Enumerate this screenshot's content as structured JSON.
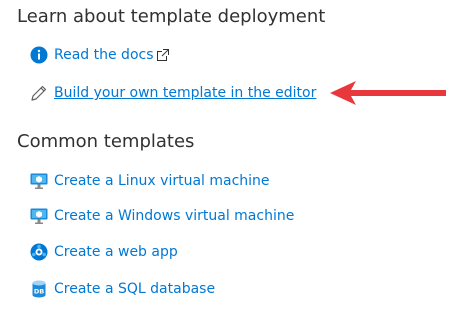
{
  "learn": {
    "heading": "Learn about template deployment",
    "links": {
      "docs": "Read the docs",
      "editor": "Build your own template in the editor"
    }
  },
  "common": {
    "heading": "Common templates",
    "links": {
      "linux": "Create a Linux virtual machine",
      "windows": "Create a Windows virtual machine",
      "webapp": "Create a web app",
      "sql": "Create a SQL database"
    },
    "sql_icon_text": "DB"
  },
  "colors": {
    "link": "#0078d4",
    "heading": "#323130",
    "annotation_arrow": "#e8383d"
  },
  "icons": {
    "docs": "info-icon",
    "external": "external-link-icon",
    "editor": "pencil-icon",
    "linux": "virtual-machine-icon",
    "windows": "virtual-machine-icon",
    "webapp": "web-app-icon",
    "sql": "sql-database-icon",
    "annotation": "red-arrow-annotation"
  }
}
